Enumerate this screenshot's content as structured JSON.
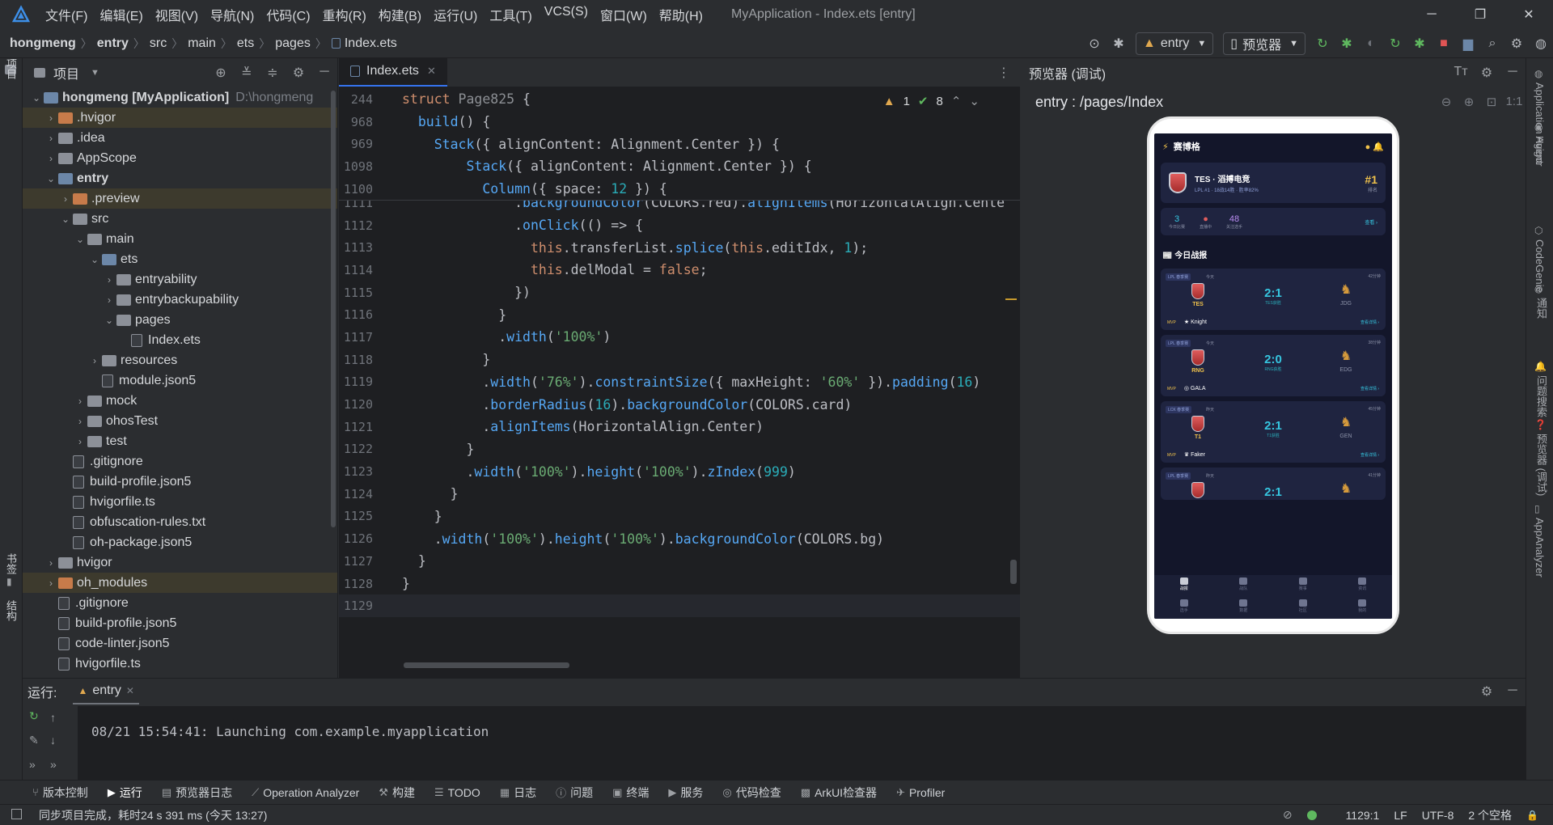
{
  "titlebar": {
    "menus": [
      "文件(F)",
      "编辑(E)",
      "视图(V)",
      "导航(N)",
      "代码(C)",
      "重构(R)",
      "构建(B)",
      "运行(U)",
      "工具(T)",
      "VCS(S)",
      "窗口(W)",
      "帮助(H)"
    ],
    "window_title": "MyApplication - Index.ets [entry]",
    "minimize": "─",
    "maximize": "❐",
    "close": "✕"
  },
  "navbar": {
    "crumbs": [
      "hongmeng",
      "entry",
      "src",
      "main",
      "ets",
      "pages",
      "Index.ets"
    ],
    "sep": "〉",
    "run_config": "entry",
    "device": "预览器",
    "icons": {
      "target": "⊙",
      "bug": "✱",
      "refresh": "↻",
      "stop": "■",
      "search": "⌕",
      "gear": "⚙",
      "avatar": "◍"
    }
  },
  "leftstrip": {
    "project_label": "项目",
    "bookmark_label": "书签",
    "structure_label": "结构"
  },
  "project": {
    "title": "项目",
    "icons": {
      "locate": "⊕",
      "collapse": "≚",
      "expand": "≑",
      "settings": "⚙",
      "hide": "─"
    },
    "rows": [
      {
        "name": "hongmeng [MyApplication]",
        "extra": "D:\\hongmeng",
        "depth": 0,
        "arrow": "⌄",
        "type": "folder-blue",
        "bold": true
      },
      {
        "name": ".hvigor",
        "depth": 1,
        "arrow": "›",
        "type": "folder-orange",
        "hl": true
      },
      {
        "name": ".idea",
        "depth": 1,
        "arrow": "›",
        "type": "folder-gray"
      },
      {
        "name": "AppScope",
        "depth": 1,
        "arrow": "›",
        "type": "folder-gray"
      },
      {
        "name": "entry",
        "depth": 1,
        "arrow": "⌄",
        "type": "folder-blue",
        "bold": true
      },
      {
        "name": ".preview",
        "depth": 2,
        "arrow": "›",
        "type": "folder-orange",
        "hl": true
      },
      {
        "name": "src",
        "depth": 2,
        "arrow": "⌄",
        "type": "folder-gray"
      },
      {
        "name": "main",
        "depth": 3,
        "arrow": "⌄",
        "type": "folder-gray"
      },
      {
        "name": "ets",
        "depth": 4,
        "arrow": "⌄",
        "type": "folder-blue"
      },
      {
        "name": "entryability",
        "depth": 5,
        "arrow": "›",
        "type": "folder-gray"
      },
      {
        "name": "entrybackupability",
        "depth": 5,
        "arrow": "›",
        "type": "folder-gray"
      },
      {
        "name": "pages",
        "depth": 5,
        "arrow": "⌄",
        "type": "folder-gray"
      },
      {
        "name": "Index.ets",
        "depth": 6,
        "arrow": "",
        "type": "file"
      },
      {
        "name": "resources",
        "depth": 4,
        "arrow": "›",
        "type": "folder-gray"
      },
      {
        "name": "module.json5",
        "depth": 4,
        "arrow": "",
        "type": "file"
      },
      {
        "name": "mock",
        "depth": 3,
        "arrow": "›",
        "type": "folder-gray"
      },
      {
        "name": "ohosTest",
        "depth": 3,
        "arrow": "›",
        "type": "folder-gray"
      },
      {
        "name": "test",
        "depth": 3,
        "arrow": "›",
        "type": "folder-gray"
      },
      {
        "name": ".gitignore",
        "depth": 2,
        "arrow": "",
        "type": "file"
      },
      {
        "name": "build-profile.json5",
        "depth": 2,
        "arrow": "",
        "type": "file"
      },
      {
        "name": "hvigorfile.ts",
        "depth": 2,
        "arrow": "",
        "type": "file"
      },
      {
        "name": "obfuscation-rules.txt",
        "depth": 2,
        "arrow": "",
        "type": "file"
      },
      {
        "name": "oh-package.json5",
        "depth": 2,
        "arrow": "",
        "type": "file"
      },
      {
        "name": "hvigor",
        "depth": 1,
        "arrow": "›",
        "type": "folder-gray"
      },
      {
        "name": "oh_modules",
        "depth": 1,
        "arrow": "›",
        "type": "folder-orange",
        "hl": true
      },
      {
        "name": ".gitignore",
        "depth": 1,
        "arrow": "",
        "type": "file"
      },
      {
        "name": "build-profile.json5",
        "depth": 1,
        "arrow": "",
        "type": "file"
      },
      {
        "name": "code-linter.json5",
        "depth": 1,
        "arrow": "",
        "type": "file"
      },
      {
        "name": "hvigorfile.ts",
        "depth": 1,
        "arrow": "",
        "type": "file"
      }
    ]
  },
  "editor": {
    "tab": "Index.ets",
    "tab_close": "✕",
    "more": "⋮",
    "warnings": "1",
    "checks": "8",
    "sticky": [
      {
        "ln": "244",
        "html": "<span class='kw'>struct</span> <span class='ident-struct'>Page825</span> {"
      },
      {
        "ln": "968",
        "html": "  <span class='fn'>build</span>() {"
      },
      {
        "ln": "969",
        "html": "    <span class='fn'>Stack</span>({ alignContent: Alignment.<span class='typ'>Center</span> }) {"
      },
      {
        "ln": "1098",
        "html": "        <span class='fn'>Stack</span>({ alignContent: Alignment.<span class='typ'>Center</span> }) {"
      },
      {
        "ln": "1100",
        "html": "          <span class='fn'>Column</span>({ space: <span class='num'>12</span> }) {"
      }
    ],
    "lines": [
      {
        "ln": "1111",
        "html": "              .<span class='fn'>backgroundColor</span>(COLORS.red).<span class='fn'>alignItems</span>(HorizontalAlign.Cente"
      },
      {
        "ln": "1112",
        "html": "              .<span class='fn'>onClick</span>(() => {"
      },
      {
        "ln": "1113",
        "html": "                <span class='kw'>this</span>.transferList.<span class='fn'>splice</span>(<span class='kw'>this</span>.editIdx, <span class='num'>1</span>);"
      },
      {
        "ln": "1114",
        "html": "                <span class='kw'>this</span>.delModal = <span class='kw'>false</span>;"
      },
      {
        "ln": "1115",
        "html": "              })"
      },
      {
        "ln": "1116",
        "html": "            }"
      },
      {
        "ln": "1117",
        "html": "            .<span class='fn'>width</span>(<span class='str'>'100%'</span>)"
      },
      {
        "ln": "1118",
        "html": "          }"
      },
      {
        "ln": "1119",
        "html": "          .<span class='fn'>width</span>(<span class='str'>'76%'</span>).<span class='fn'>constraintSize</span>({ maxHeight: <span class='str'>'60%'</span> }).<span class='fn'>padding</span>(<span class='num'>16</span>)"
      },
      {
        "ln": "1120",
        "html": "          .<span class='fn'>borderRadius</span>(<span class='num'>16</span>).<span class='fn'>backgroundColor</span>(COLORS.card)"
      },
      {
        "ln": "1121",
        "html": "          .<span class='fn'>alignItems</span>(HorizontalAlign.Center)"
      },
      {
        "ln": "1122",
        "html": "        }"
      },
      {
        "ln": "1123",
        "html": "        .<span class='fn'>width</span>(<span class='str'>'100%'</span>).<span class='fn'>height</span>(<span class='str'>'100%'</span>).<span class='fn'>zIndex</span>(<span class='num'>999</span>)"
      },
      {
        "ln": "1124",
        "html": "      }"
      },
      {
        "ln": "1125",
        "html": "    }"
      },
      {
        "ln": "1126",
        "html": "    .<span class='fn'>width</span>(<span class='str'>'100%'</span>).<span class='fn'>height</span>(<span class='str'>'100%'</span>).<span class='fn'>backgroundColor</span>(COLORS.bg)"
      },
      {
        "ln": "1127",
        "html": "  }"
      },
      {
        "ln": "1128",
        "html": "}"
      },
      {
        "ln": "1129",
        "html": ""
      }
    ]
  },
  "preview": {
    "title": "预览器 (调试)",
    "route": "entry : /pages/Index",
    "icons": {
      "font": "Tт",
      "gear": "⚙",
      "hide": "─",
      "zoom_out": "⊖",
      "zoom_in": "⊕",
      "fit": "⊡",
      "ratio": "1:1"
    },
    "phone": {
      "app_title": "赛博格",
      "header_right": "● 🔔",
      "rank": {
        "team": "TES · 滔搏电竞",
        "sub": "LPL #1 · 18战14胜 · 胜率82%",
        "no": "#1",
        "no_sub": "排名"
      },
      "stats": [
        {
          "v": "3",
          "l": "今日比赛",
          "color": "#36c6e0"
        },
        {
          "v": "●",
          "l": "直播中",
          "color": "#e05d5d"
        },
        {
          "v": "48",
          "l": "关注选手",
          "color": "#b98cf0"
        }
      ],
      "stats_more": "查看 ›",
      "section": "📰 今日战报",
      "matches": [
        {
          "tag": "LPL 春季赛",
          "when": "今天",
          "time": "42分钟",
          "left": "TES",
          "right": "JDG",
          "score": "2:1",
          "score_sub": "TES获胜",
          "mvp_label": "MVP",
          "mvp": "★  Knight",
          "det": "查看详情 ›"
        },
        {
          "tag": "LPL 春季赛",
          "when": "今天",
          "time": "38分钟",
          "left": "RNG",
          "right": "EDG",
          "score": "2:0",
          "score_sub": "RNG获胜",
          "mvp_label": "MVP",
          "mvp": "◎  GALA",
          "det": "查看详情 ›"
        },
        {
          "tag": "LCK 春季赛",
          "when": "昨天",
          "time": "45分钟",
          "left": "T1",
          "right": "GEN",
          "score": "2:1",
          "score_sub": "T1获胜",
          "mvp_label": "MVP",
          "mvp": "♛  Faker",
          "det": "查看详情 ›"
        },
        {
          "tag": "LPL 春季赛",
          "when": "昨天",
          "time": "41分钟",
          "left": "",
          "right": "",
          "score": "2:1",
          "score_sub": "",
          "mvp_label": "",
          "mvp": "",
          "det": ""
        }
      ],
      "nav": [
        "战报",
        "战队",
        "赛事",
        "资讯",
        "选手",
        "数据",
        "社区",
        "我的"
      ]
    }
  },
  "rightstrip": [
    "Application Agent",
    "Hvigor",
    "CodeGenie",
    "通知",
    "问题搜索",
    "预览器 (调试)",
    "AppAnalyzer"
  ],
  "runpanel": {
    "label": "运行:",
    "tab": "entry",
    "tab_close": "✕",
    "log": "08/21 15:54:41: Launching com.example.myapplication",
    "icons": {
      "gear": "⚙",
      "hide": "─",
      "rerun": "↻",
      "up": "↑",
      "down": "↓",
      "wrench": "✎",
      "more": "»"
    }
  },
  "bottombar": [
    {
      "icon": "⑂",
      "label": "版本控制"
    },
    {
      "icon": "▶",
      "label": "运行",
      "active": true
    },
    {
      "icon": "▤",
      "label": "预览器日志"
    },
    {
      "icon": "⟋",
      "label": "Operation Analyzer"
    },
    {
      "icon": "⚒",
      "label": "构建"
    },
    {
      "icon": "☰",
      "label": "TODO"
    },
    {
      "icon": "▦",
      "label": "日志"
    },
    {
      "icon": "ⓘ",
      "label": "问题"
    },
    {
      "icon": "▣",
      "label": "终端"
    },
    {
      "icon": "▶",
      "label": "服务"
    },
    {
      "icon": "◎",
      "label": "代码检查"
    },
    {
      "icon": "▩",
      "label": "ArkUI检查器"
    },
    {
      "icon": "✈",
      "label": "Profiler"
    }
  ],
  "statusbar": {
    "message": "同步项目完成，耗时24 s 391 ms (今天 13:27)",
    "position": "1129:1",
    "line_sep": "LF",
    "encoding": "UTF-8",
    "indent": "2 个空格",
    "lock": "🔒"
  }
}
